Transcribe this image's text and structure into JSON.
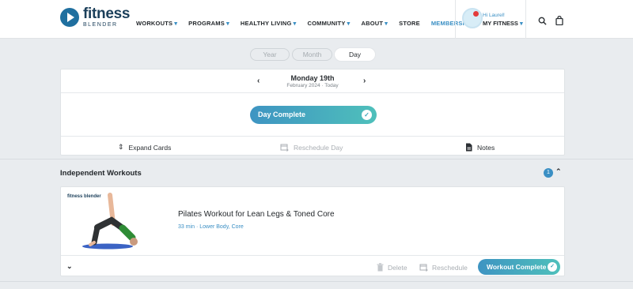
{
  "brand": {
    "line1": "fitness",
    "line2": "BLENDER",
    "accent": "#3a8fc4",
    "navy": "#1b3f5a"
  },
  "nav": [
    {
      "label": "WORKOUTS",
      "caret": "▾"
    },
    {
      "label": "PROGRAMS",
      "caret": "▾"
    },
    {
      "label": "HEALTHY LIVING",
      "caret": "▾"
    },
    {
      "label": "COMMUNITY",
      "caret": "▾"
    },
    {
      "label": "ABOUT",
      "caret": "▾"
    },
    {
      "label": "STORE",
      "caret": ""
    },
    {
      "label": "MEMBERSHIP",
      "caret": ""
    }
  ],
  "user": {
    "greeting": "Hi Laurel!",
    "menu_label": "MY FITNESS",
    "caret": "▾"
  },
  "icons": {
    "search": "search-icon",
    "bag": "shopping-bag-icon"
  },
  "view_toggle": {
    "year": "Year",
    "month": "Month",
    "day": "Day",
    "selected": "Day"
  },
  "day_panel": {
    "date_title": "Monday 19th",
    "date_sub": "February 2024 · Today",
    "prev": "‹",
    "next": "›",
    "day_complete_label": "Day Complete",
    "actions": {
      "expand": "Expand Cards",
      "reschedule": "Reschedule Day",
      "notes": "Notes"
    }
  },
  "section": {
    "title": "Independent Workouts",
    "count": "1"
  },
  "workout": {
    "thumb_logo": "fitness blender",
    "title": "Pilates Workout for Lean Legs & Toned Core",
    "meta": "33 min · Lower Body, Core",
    "delete_label": "Delete",
    "reschedule_label": "Reschedule",
    "complete_label": "Workout Complete"
  },
  "gradient": {
    "start": "#3e94c2",
    "end": "#4fc0bb"
  }
}
